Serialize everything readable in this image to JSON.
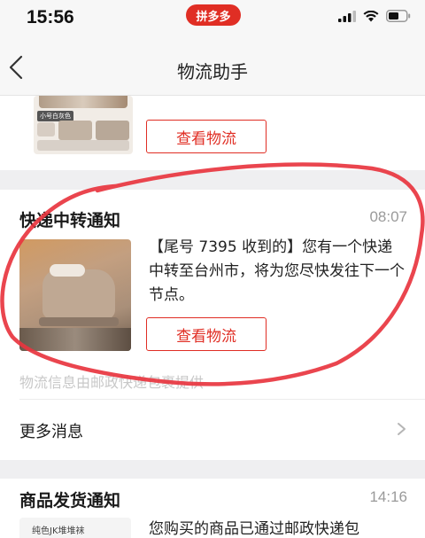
{
  "status_bar": {
    "time": "15:56",
    "app_badge": "拼多多"
  },
  "nav": {
    "title": "物流助手"
  },
  "cards": [
    {
      "thumb_caption": "小号白灰色",
      "button_label": "查看物流"
    },
    {
      "title": "快递中转通知",
      "time": "08:07",
      "message": "【尾号 7395 收到的】您有一个快递中转至台州市，将为您尽快发往下一个节点。",
      "button_label": "查看物流",
      "provider_note": "物流信息由邮政快递包裹提供",
      "more_label": "更多消息"
    },
    {
      "title": "商品发货通知",
      "time": "14:16",
      "thumb_caption": "纯色JK堆堆袜",
      "message": "您购买的商品已通过邮政快递包"
    }
  ],
  "colors": {
    "brand_red": "#e02e24",
    "annotation_red": "#e8353f"
  },
  "icons": {
    "back": "chevron-left-icon",
    "more": "chevron-right-icon",
    "signal": "cellular-signal-icon",
    "wifi": "wifi-icon",
    "battery": "battery-icon"
  }
}
